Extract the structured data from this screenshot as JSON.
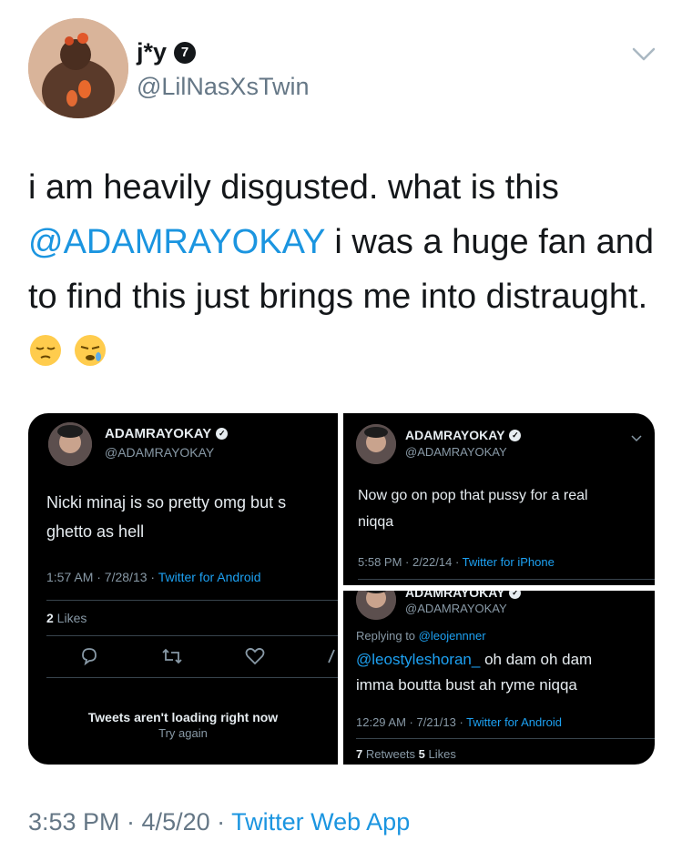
{
  "author": {
    "display_name": "j*y",
    "badge": "7",
    "handle": "@LilNasXsTwin"
  },
  "tweet": {
    "text_part1": "i am heavily disgusted. what is this ",
    "mention": "@ADAMRAYOKAY",
    "text_part2": " i was a huge fan and to find this just brings me into distraught. "
  },
  "emojis": [
    "pensive-face-emoji",
    "sleepy-face-emoji"
  ],
  "media": {
    "panel1": {
      "name": "ADAMRAYOKAY",
      "handle": "@ADAMRAYOKAY",
      "text_line1": "Nicki minaj is so pretty omg but s",
      "text_line2": "ghetto as hell",
      "meta_time": "1:57 AM · 7/28/13 · ",
      "meta_source": "Twitter for Android",
      "likes_count": "2",
      "likes_label": " Likes",
      "loading_title": "Tweets aren't loading right now",
      "loading_retry": "Try again"
    },
    "panel2": {
      "name": "ADAMRAYOKAY",
      "handle": "@ADAMRAYOKAY",
      "text_line1": "Now go on pop that pussy for a real",
      "text_line2": "niqqa",
      "meta_time": "5:58 PM · 2/22/14 · ",
      "meta_source": "Twitter for iPhone"
    },
    "panel3": {
      "name": "ADAMRAYOKAY",
      "handle": "@ADAMRAYOKAY",
      "replying_prefix": "Replying to ",
      "replying_to": "@leojennner",
      "mention": "@leostyleshoran_",
      "text_line1": " oh dam oh dam",
      "text_line2": "imma boutta bust ah ryme niqqa",
      "meta_time": "12:29 AM · 7/21/13 · ",
      "meta_source": "Twitter for Android",
      "retweets_count": "7",
      "retweets_label": " Retweets ",
      "likes_count": "5",
      "likes_label": " Likes"
    }
  },
  "footer": {
    "timestamp": "3:53 PM · 4/5/20 · ",
    "app": "Twitter Web App"
  },
  "colors": {
    "link": "#1b95e0",
    "secondary_text": "#657786",
    "dark_background": "#000000"
  }
}
